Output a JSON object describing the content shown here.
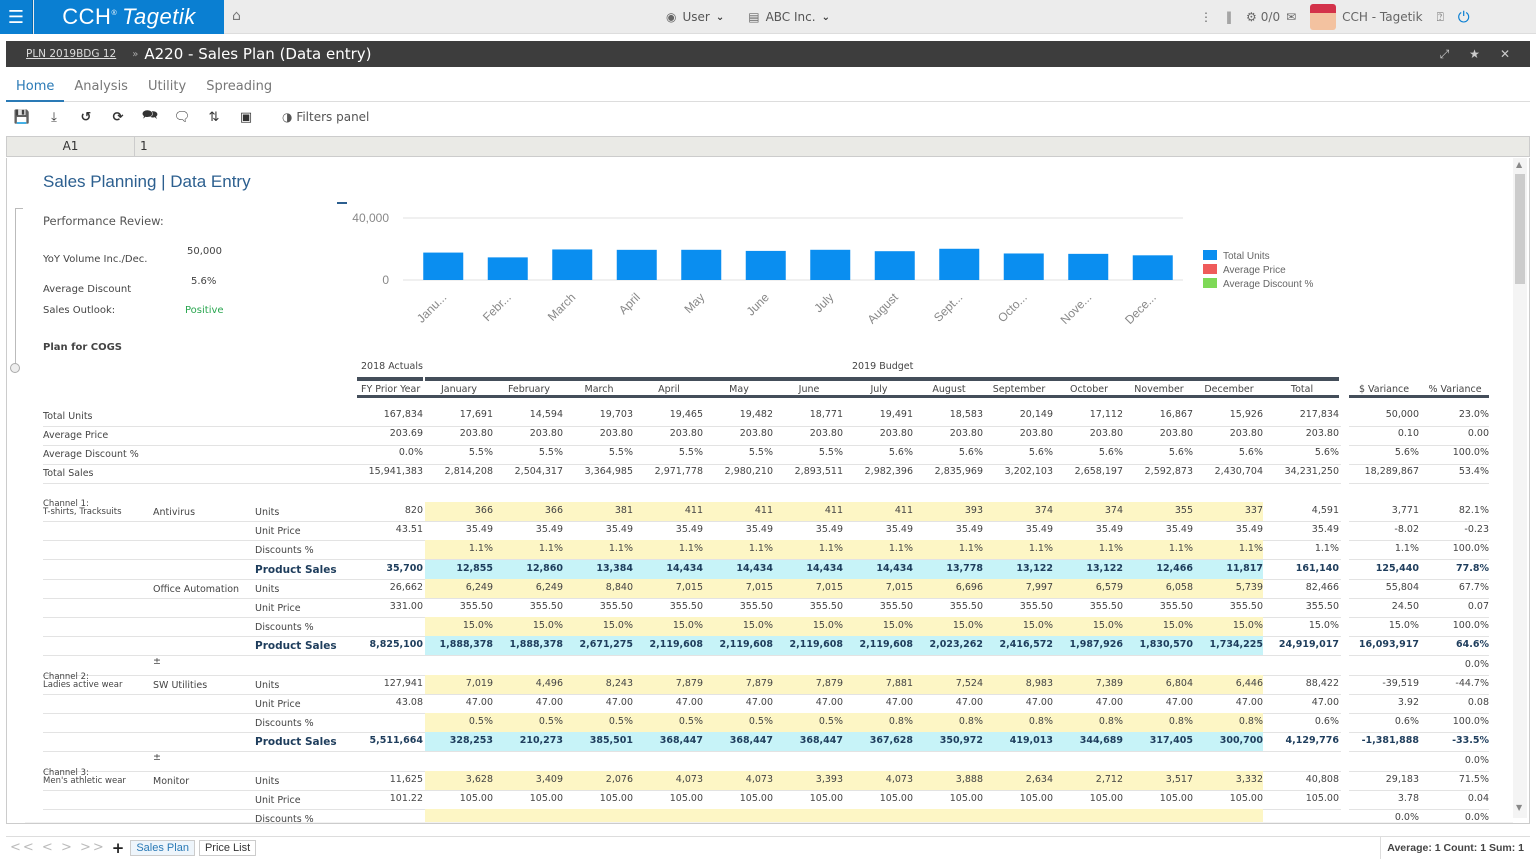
{
  "app": {
    "brand": "CCH",
    "brand_italic": "Tagetik",
    "menu_icon": "hamburger-icon",
    "home_icon": "home-icon"
  },
  "topbar": {
    "user_label": "User",
    "entity_label": "ABC Inc.",
    "messages_count": "0/0",
    "account_name": "CCH - Tagetik"
  },
  "titlebar": {
    "breadcrumb": "PLN 2019BDG 12",
    "separator": "»",
    "title": "A220 - Sales Plan (Data entry)"
  },
  "tabs": [
    {
      "label": "Home",
      "active": true
    },
    {
      "label": "Analysis",
      "active": false
    },
    {
      "label": "Utility",
      "active": false
    },
    {
      "label": "Spreading",
      "active": false
    }
  ],
  "toolbar": {
    "filters_label": "Filters panel"
  },
  "formula_bar": {
    "cell_ref": "A1",
    "cell_value": "1"
  },
  "sheet": {
    "title": "Sales Planning | Data Entry",
    "performance_label": "Performance Review:",
    "kpis": [
      {
        "label": "YoY Volume Inc./Dec.",
        "value": "50,000"
      },
      {
        "label": "Average Discount",
        "value": "5.6%"
      },
      {
        "label": "Sales Outlook:",
        "value": "Positive"
      }
    ],
    "plan_label": "Plan for COGS",
    "group_actuals": "2018 Actuals",
    "group_budget": "2019 Budget",
    "columns": [
      "FY Prior Year",
      "January",
      "February",
      "March",
      "April",
      "May",
      "June",
      "July",
      "August",
      "September",
      "October",
      "November",
      "December",
      "Total",
      "$ Variance",
      "% Variance"
    ],
    "summary_rows": [
      {
        "label": "Total Units",
        "values": [
          "167,834",
          "17,691",
          "14,594",
          "19,703",
          "19,465",
          "19,482",
          "18,771",
          "19,491",
          "18,583",
          "20,149",
          "17,112",
          "16,867",
          "15,926",
          "217,834",
          "50,000",
          "23.0%"
        ]
      },
      {
        "label": "Average Price",
        "values": [
          "203.69",
          "203.80",
          "203.80",
          "203.80",
          "203.80",
          "203.80",
          "203.80",
          "203.80",
          "203.80",
          "203.80",
          "203.80",
          "203.80",
          "203.80",
          "203.80",
          "0.10",
          "0.00"
        ]
      },
      {
        "label": "Average Discount %",
        "values": [
          "0.0%",
          "5.5%",
          "5.5%",
          "5.5%",
          "5.5%",
          "5.5%",
          "5.5%",
          "5.6%",
          "5.6%",
          "5.6%",
          "5.6%",
          "5.6%",
          "5.6%",
          "5.6%",
          "5.6%",
          "100.0%"
        ]
      },
      {
        "label": "Total Sales",
        "values": [
          "15,941,383",
          "2,814,208",
          "2,504,317",
          "3,364,985",
          "2,971,778",
          "2,980,210",
          "2,893,511",
          "2,982,396",
          "2,835,969",
          "3,202,103",
          "2,658,197",
          "2,592,873",
          "2,430,704",
          "34,231,250",
          "18,289,867",
          "53.4%"
        ]
      }
    ],
    "detail_rows": [
      {
        "channel": "Channel 1:",
        "channel_sub": "T-shirts, Tracksuits",
        "product": "Antivirus",
        "measure": "Units",
        "kind": "units",
        "values": [
          "820",
          "366",
          "366",
          "381",
          "411",
          "411",
          "411",
          "411",
          "393",
          "374",
          "374",
          "355",
          "337",
          "4,591",
          "3,771",
          "82.1%"
        ]
      },
      {
        "channel": "",
        "channel_sub": "",
        "product": "",
        "measure": "Unit Price",
        "kind": "price",
        "values": [
          "43.51",
          "35.49",
          "35.49",
          "35.49",
          "35.49",
          "35.49",
          "35.49",
          "35.49",
          "35.49",
          "35.49",
          "35.49",
          "35.49",
          "35.49",
          "35.49",
          "-8.02",
          "-0.23"
        ]
      },
      {
        "channel": "",
        "channel_sub": "",
        "product": "",
        "measure": "Discounts %",
        "kind": "disc",
        "values": [
          "",
          "1.1%",
          "1.1%",
          "1.1%",
          "1.1%",
          "1.1%",
          "1.1%",
          "1.1%",
          "1.1%",
          "1.1%",
          "1.1%",
          "1.1%",
          "1.1%",
          "1.1%",
          "1.1%",
          "100.0%"
        ]
      },
      {
        "channel": "",
        "channel_sub": "",
        "product": "",
        "measure": "Product Sales",
        "kind": "sales",
        "values": [
          "35,700",
          "12,855",
          "12,860",
          "13,384",
          "14,434",
          "14,434",
          "14,434",
          "14,434",
          "13,778",
          "13,122",
          "13,122",
          "12,466",
          "11,817",
          "161,140",
          "125,440",
          "77.8%"
        ]
      },
      {
        "channel": "",
        "channel_sub": "",
        "product": "Office Automation",
        "measure": "Units",
        "kind": "units",
        "values": [
          "26,662",
          "6,249",
          "6,249",
          "8,840",
          "7,015",
          "7,015",
          "7,015",
          "7,015",
          "6,696",
          "7,997",
          "6,579",
          "6,058",
          "5,739",
          "82,466",
          "55,804",
          "67.7%"
        ]
      },
      {
        "channel": "",
        "channel_sub": "",
        "product": "",
        "measure": "Unit Price",
        "kind": "price",
        "values": [
          "331.00",
          "355.50",
          "355.50",
          "355.50",
          "355.50",
          "355.50",
          "355.50",
          "355.50",
          "355.50",
          "355.50",
          "355.50",
          "355.50",
          "355.50",
          "355.50",
          "24.50",
          "0.07"
        ]
      },
      {
        "channel": "",
        "channel_sub": "",
        "product": "",
        "measure": "Discounts %",
        "kind": "disc",
        "values": [
          "",
          "15.0%",
          "15.0%",
          "15.0%",
          "15.0%",
          "15.0%",
          "15.0%",
          "15.0%",
          "15.0%",
          "15.0%",
          "15.0%",
          "15.0%",
          "15.0%",
          "15.0%",
          "15.0%",
          "100.0%"
        ]
      },
      {
        "channel": "",
        "channel_sub": "",
        "product": "",
        "measure": "Product Sales",
        "kind": "sales",
        "values": [
          "8,825,100",
          "1,888,378",
          "1,888,378",
          "2,671,275",
          "2,119,608",
          "2,119,608",
          "2,119,608",
          "2,119,608",
          "2,023,262",
          "2,416,572",
          "1,987,926",
          "1,830,570",
          "1,734,225",
          "24,919,017",
          "16,093,917",
          "64.6%"
        ]
      },
      {
        "channel": "",
        "channel_sub": "",
        "product": "±",
        "measure": "",
        "kind": "spacer",
        "values": [
          "",
          "",
          "",
          "",
          "",
          "",
          "",
          "",
          "",
          "",
          "",
          "",
          "",
          "",
          "",
          "0.0%"
        ]
      },
      {
        "channel": "Channel 2:",
        "channel_sub": "Ladies active wear",
        "product": "SW Utilities",
        "measure": "Units",
        "kind": "units",
        "values": [
          "127,941",
          "7,019",
          "4,496",
          "8,243",
          "7,879",
          "7,879",
          "7,879",
          "7,881",
          "7,524",
          "8,983",
          "7,389",
          "6,804",
          "6,446",
          "88,422",
          "-39,519",
          "-44.7%"
        ]
      },
      {
        "channel": "",
        "channel_sub": "",
        "product": "",
        "measure": "Unit Price",
        "kind": "price",
        "values": [
          "43.08",
          "47.00",
          "47.00",
          "47.00",
          "47.00",
          "47.00",
          "47.00",
          "47.00",
          "47.00",
          "47.00",
          "47.00",
          "47.00",
          "47.00",
          "47.00",
          "3.92",
          "0.08"
        ]
      },
      {
        "channel": "",
        "channel_sub": "",
        "product": "",
        "measure": "Discounts %",
        "kind": "disc",
        "values": [
          "",
          "0.5%",
          "0.5%",
          "0.5%",
          "0.5%",
          "0.5%",
          "0.5%",
          "0.8%",
          "0.8%",
          "0.8%",
          "0.8%",
          "0.8%",
          "0.8%",
          "0.6%",
          "0.6%",
          "100.0%"
        ]
      },
      {
        "channel": "",
        "channel_sub": "",
        "product": "",
        "measure": "Product Sales",
        "kind": "sales",
        "values": [
          "5,511,664",
          "328,253",
          "210,273",
          "385,501",
          "368,447",
          "368,447",
          "368,447",
          "367,628",
          "350,972",
          "419,013",
          "344,689",
          "317,405",
          "300,700",
          "4,129,776",
          "-1,381,888",
          "-33.5%"
        ]
      },
      {
        "channel": "",
        "channel_sub": "",
        "product": "±",
        "measure": "",
        "kind": "spacer",
        "values": [
          "",
          "",
          "",
          "",
          "",
          "",
          "",
          "",
          "",
          "",
          "",
          "",
          "",
          "",
          "",
          "0.0%"
        ]
      },
      {
        "channel": "Channel 3:",
        "channel_sub": "Men's athletic wear",
        "product": "Monitor",
        "measure": "Units",
        "kind": "units",
        "values": [
          "11,625",
          "3,628",
          "3,409",
          "2,076",
          "4,073",
          "4,073",
          "3,393",
          "4,073",
          "3,888",
          "2,634",
          "2,712",
          "3,517",
          "3,332",
          "40,808",
          "29,183",
          "71.5%"
        ]
      },
      {
        "channel": "",
        "channel_sub": "",
        "product": "",
        "measure": "Unit Price",
        "kind": "price",
        "values": [
          "101.22",
          "105.00",
          "105.00",
          "105.00",
          "105.00",
          "105.00",
          "105.00",
          "105.00",
          "105.00",
          "105.00",
          "105.00",
          "105.00",
          "105.00",
          "105.00",
          "3.78",
          "0.04"
        ]
      },
      {
        "channel": "",
        "channel_sub": "",
        "product": "",
        "measure": "Discounts %",
        "kind": "disc",
        "values": [
          "",
          "",
          "",
          "",
          "",
          "",
          "",
          "",
          "",
          "",
          "",
          "",
          "",
          "",
          "0.0%",
          "0.0%"
        ]
      }
    ]
  },
  "chart_data": {
    "type": "bar",
    "categories": [
      "Janu...",
      "Febr...",
      "March",
      "April",
      "May",
      "June",
      "July",
      "August",
      "Sept...",
      "Octo...",
      "Nove...",
      "Dece..."
    ],
    "series": [
      {
        "name": "Total Units",
        "color": "#0a8ef0",
        "values": [
          17691,
          14594,
          19703,
          19465,
          19482,
          18771,
          19491,
          18583,
          20149,
          17112,
          16867,
          15926
        ]
      },
      {
        "name": "Average Price",
        "color": "#ef5b5b",
        "values": []
      },
      {
        "name": "Average Discount %",
        "color": "#7ed957",
        "values": []
      }
    ],
    "y_ticks": [
      "0",
      "40,000"
    ],
    "ylim": [
      0,
      40000
    ],
    "grid": true,
    "legend": "right"
  },
  "footer": {
    "nav": "<< < > >>",
    "add": "+",
    "sheet_tabs": [
      {
        "label": "Sales Plan",
        "active": true
      },
      {
        "label": "Price List",
        "active": false
      }
    ],
    "status": "Average: 1 Count: 1 Sum: 1"
  }
}
